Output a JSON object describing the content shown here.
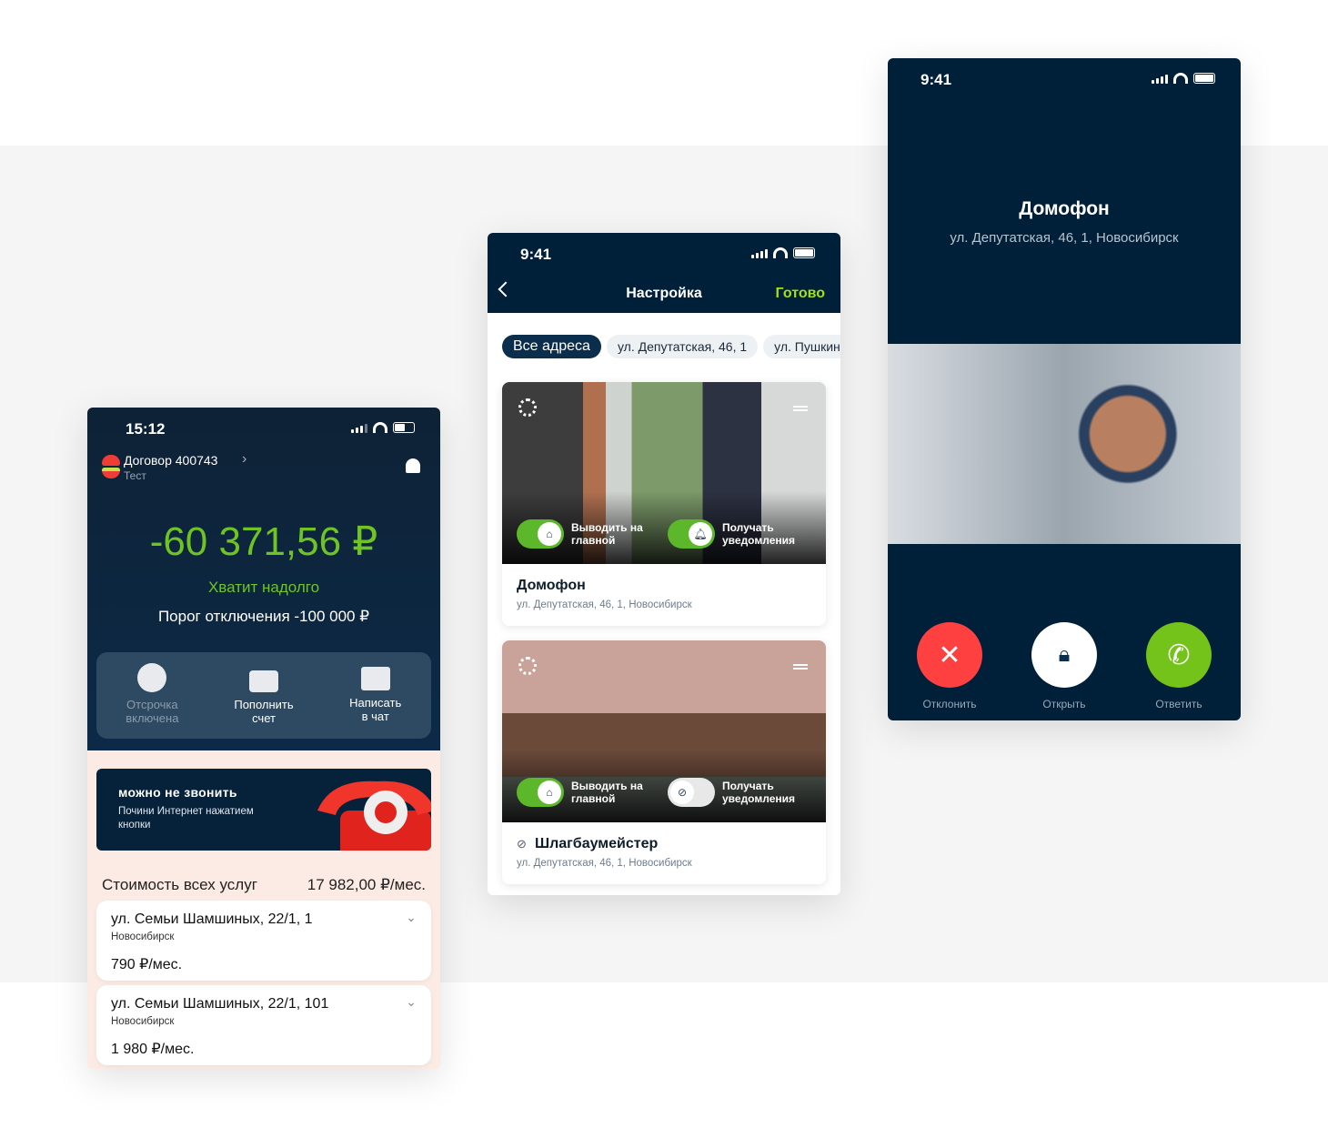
{
  "balance_screen": {
    "time": "15:12",
    "contract": "Договор 400743",
    "subtitle": "Тест",
    "balance": "-60 371,56 ₽",
    "status": "Хватит надолго",
    "threshold": "Порог отключения -100 000 ₽",
    "actions": [
      {
        "label1": "Отсрочка",
        "label2": "включена",
        "icon": "clock-icon"
      },
      {
        "label1": "Пополнить",
        "label2": "счет",
        "icon": "wallet-icon"
      },
      {
        "label1": "Написать",
        "label2": "в чат",
        "icon": "chat-icon"
      }
    ],
    "promo": {
      "title": "можно не звонить",
      "text": "Почини Интернет нажатием кнопки"
    },
    "total_label": "Стоимость всех услуг",
    "total_value": "17 982,00 ₽/мес.",
    "addresses": [
      {
        "address": "ул. Семьи Шамшиных, 22/1, 1",
        "city": "Новосибирск",
        "price": "790 ₽/мес."
      },
      {
        "address": "ул. Семьи Шамшиных, 22/1, 101",
        "city": "Новосибирск",
        "price": "1 980 ₽/мес."
      }
    ]
  },
  "settings_screen": {
    "time": "9:41",
    "title": "Настройка",
    "done": "Готово",
    "chips": [
      "Все адреса",
      "ул. Депутатская, 46, 1",
      "ул. Пушкин"
    ],
    "cameras": [
      {
        "name": "Домофон",
        "address": "ул. Депутатская, 46, 1, Новосибирск",
        "show_on_main": true,
        "notifications": true
      },
      {
        "name": "Шлагбаумейстер",
        "address": "ул. Депутатская, 46, 1, Новосибирск",
        "show_on_main": true,
        "notifications": false
      }
    ],
    "toggle_main": "Выводить на главной",
    "toggle_notify": "Получать уведомления"
  },
  "call_screen": {
    "time": "9:41",
    "title": "Домофон",
    "address": "ул. Депутатская, 46, 1, Новосибирск",
    "decline": "Отклонить",
    "open": "Открыть",
    "answer": "Ответить",
    "colors": {
      "decline": "#ff4040",
      "open": "#ffffff",
      "answer": "#74c31a",
      "accent": "#a4e01a",
      "navy": "#00203a"
    }
  }
}
